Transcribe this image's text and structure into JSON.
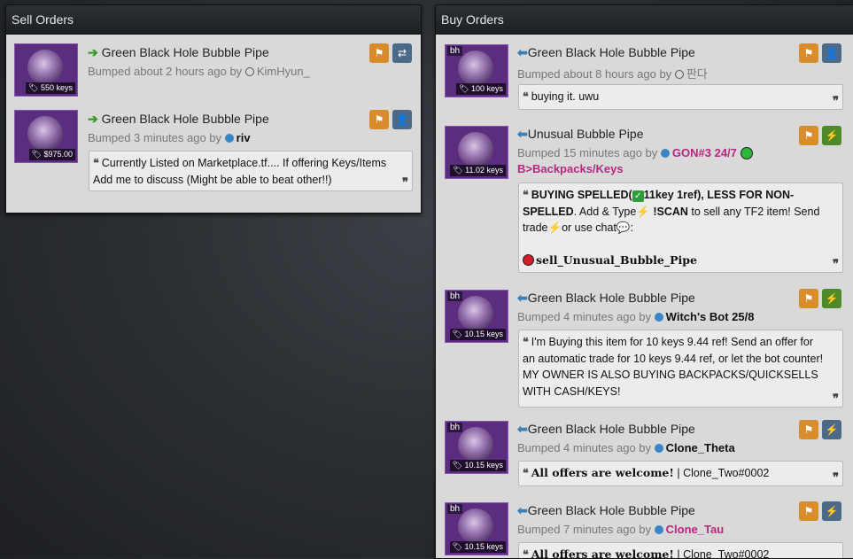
{
  "sell_panel": {
    "title": "Sell Orders",
    "orders": [
      {
        "item": "Green Black Hole Bubble Pipe",
        "price": "550 keys",
        "bumped": "Bumped about 2 hours ago by",
        "user": "KimHyun_"
      },
      {
        "item": "Green Black Hole Bubble Pipe",
        "price": "$975.00",
        "bumped": "Bumped 3 minutes ago by",
        "user": "riv",
        "comment": "Currently Listed on Marketplace.tf.... If offering Keys/Items Add me to discuss (Might be able to beat other!!)"
      }
    ]
  },
  "buy_panel": {
    "title": "Buy Orders",
    "orders": [
      {
        "badge": "bh",
        "item": "Green Black Hole Bubble Pipe",
        "price": "100 keys",
        "bumped": "Bumped about 8 hours ago by",
        "user": "판다",
        "comment": "buying it. uwu"
      },
      {
        "item": "Unusual Bubble Pipe",
        "price": "11.02 keys",
        "bumped": "Bumped 15 minutes ago by",
        "user": "GON#3 24/7",
        "user2": "B>Backpacks/Keys",
        "comment_parts": {
          "a": "BUYING SPELLED(",
          "b": "11key 1ref)",
          "c": ", LESS FOR NON-SPELLED",
          "d": ". Add & Type",
          "e": " !SCAN",
          "f": " to sell any TF2 item! Send trade",
          "g": "or use chat",
          "h": ":",
          "i": "sell_Unusual_Bubble_Pipe"
        }
      },
      {
        "badge": "bh",
        "item": "Green Black Hole Bubble Pipe",
        "price": "10.15 keys",
        "bumped": "Bumped 4 minutes ago by",
        "user": "Witch's Bot 25/8",
        "comment": "I'm Buying this item for 10 keys 9.44 ref! Send an offer for an automatic trade for 10 keys 9.44 ref, or let the bot counter! MY OWNER IS ALSO BUYING BACKPACKS/QUICKSELLS WITH CASH/KEYS!"
      },
      {
        "badge": "bh",
        "item": "Green Black Hole Bubble Pipe",
        "price": "10.15 keys",
        "bumped": "Bumped 4 minutes ago by",
        "user": "Clone_Theta",
        "comment_bold": "All offers are welcome!",
        "comment_rest": " | Clone_Two#0002"
      },
      {
        "badge": "bh",
        "item": "Green Black Hole Bubble Pipe",
        "price": "10.15 keys",
        "bumped": "Bumped 7 minutes ago by",
        "user": "Clone_Tau",
        "comment_bold": "All offers are welcome!",
        "comment_rest": " | Clone_Two#0002"
      }
    ]
  },
  "icons": {
    "arrow_sell": "arrow-right-icon",
    "arrow_buy": "arrow-left-icon",
    "flag": "flag-icon",
    "trade": "exchange-icon",
    "add_friend": "user-plus-icon",
    "bolt": "lightning-icon",
    "tag": "tag-icon",
    "quote": "quote-icon"
  },
  "colors": {
    "flag_btn": "#d98c2b",
    "friend_btn": "#4c6a88",
    "bot_btn": "#4f8a2a",
    "pink_user": "#b5287f",
    "panel_bg": "#d9d9d9"
  }
}
